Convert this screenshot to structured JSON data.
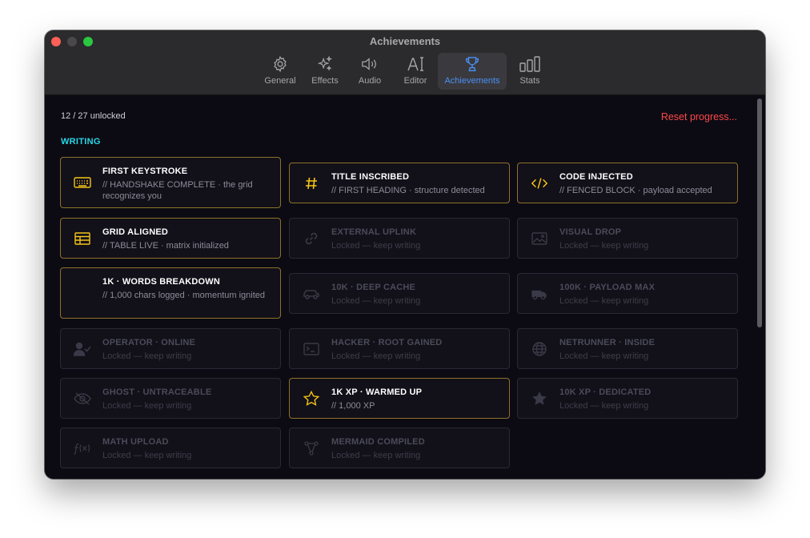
{
  "window": {
    "title": "Achievements"
  },
  "tabs": [
    {
      "label": "General",
      "icon": "gear-icon"
    },
    {
      "label": "Effects",
      "icon": "sparkles-icon"
    },
    {
      "label": "Audio",
      "icon": "speaker-icon"
    },
    {
      "label": "Editor",
      "icon": "text-cursor-icon"
    },
    {
      "label": "Achievements",
      "icon": "trophy-icon",
      "active": true
    },
    {
      "label": "Stats",
      "icon": "bar-chart-icon"
    }
  ],
  "progress_text": "12 / 27 unlocked",
  "reset_label": "Reset progress...",
  "section": "WRITING",
  "colors": {
    "accent_gold": "#f5c518",
    "accent_cyan": "#28d6e6",
    "reset_red": "#ff4747",
    "active_tab_blue": "#4a90f5"
  },
  "cards": [
    {
      "title": "FIRST KEYSTROKE",
      "desc": "// HANDSHAKE COMPLETE · the grid recognizes you",
      "icon": "keyboard-icon",
      "unlocked": true
    },
    {
      "title": "TITLE INSCRIBED",
      "desc": "// FIRST HEADING · structure detected",
      "icon": "hash-icon",
      "unlocked": true
    },
    {
      "title": "CODE INJECTED",
      "desc": "// FENCED BLOCK · payload accepted",
      "icon": "code-icon",
      "unlocked": true
    },
    {
      "title": "GRID ALIGNED",
      "desc": "// TABLE LIVE · matrix initialized",
      "icon": "table-icon",
      "unlocked": true
    },
    {
      "title": "EXTERNAL UPLINK",
      "desc": "Locked — keep writing",
      "icon": "link-icon",
      "unlocked": false
    },
    {
      "title": "VISUAL DROP",
      "desc": "Locked — keep writing",
      "icon": "image-icon",
      "unlocked": false
    },
    {
      "title": "1K · WORDS BREAKDOWN",
      "desc": "// 1,000 chars logged · momentum ignited",
      "icon": "none",
      "unlocked": true
    },
    {
      "title": "10K · DEEP CACHE",
      "desc": "Locked — keep writing",
      "icon": "car-icon",
      "unlocked": false
    },
    {
      "title": "100K · PAYLOAD MAX",
      "desc": "Locked — keep writing",
      "icon": "truck-icon",
      "unlocked": false
    },
    {
      "title": "OPERATOR · ONLINE",
      "desc": "Locked — keep writing",
      "icon": "user-check-icon",
      "unlocked": false
    },
    {
      "title": "HACKER · ROOT GAINED",
      "desc": "Locked — keep writing",
      "icon": "terminal-icon",
      "unlocked": false
    },
    {
      "title": "NETRUNNER · INSIDE",
      "desc": "Locked — keep writing",
      "icon": "globe-icon",
      "unlocked": false
    },
    {
      "title": "GHOST · UNTRACEABLE",
      "desc": "Locked — keep writing",
      "icon": "eye-slash-icon",
      "unlocked": false
    },
    {
      "title": "1K XP · WARMED UP",
      "desc": "// 1,000 XP",
      "icon": "star-outline-icon",
      "unlocked": true
    },
    {
      "title": "10K XP · DEDICATED",
      "desc": "Locked — keep writing",
      "icon": "star-filled-icon",
      "unlocked": false
    },
    {
      "title": "MATH UPLOAD",
      "desc": "Locked — keep writing",
      "icon": "function-icon",
      "unlocked": false
    },
    {
      "title": "MERMAID COMPILED",
      "desc": "Locked — keep writing",
      "icon": "diagram-icon",
      "unlocked": false
    }
  ]
}
